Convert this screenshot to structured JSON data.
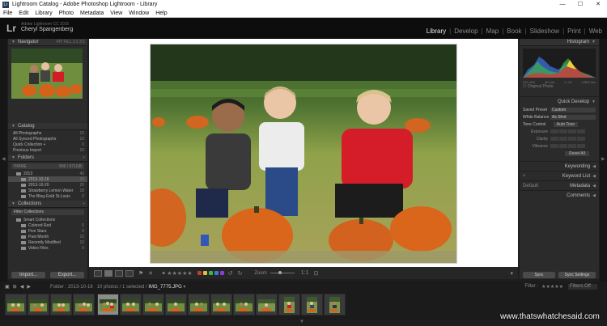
{
  "window": {
    "title": "Lightroom Catalog - Adobe Photoshop Lightroom - Library",
    "minimize": "—",
    "maximize": "☐",
    "close": "✕"
  },
  "menu": [
    "File",
    "Edit",
    "Library",
    "Photo",
    "Metadata",
    "View",
    "Window",
    "Help"
  ],
  "identity": {
    "logo": "Lr",
    "account": "Adobe Lightroom CC 2015",
    "user": "Cheryl Spangenberg"
  },
  "modules": [
    "Library",
    "Develop",
    "Map",
    "Book",
    "Slideshow",
    "Print",
    "Web"
  ],
  "active_module": "Library",
  "left_panel": {
    "navigator": {
      "title": "Navigator",
      "options": "FIT  FILL  1:1  3:1"
    },
    "catalog": {
      "title": "Catalog",
      "items": [
        {
          "label": "All Photographs",
          "count": "10"
        },
        {
          "label": "All Synced Photographs",
          "count": "10"
        },
        {
          "label": "Quick Collection +",
          "count": "0"
        },
        {
          "label": "Previous Import",
          "count": "10"
        }
      ]
    },
    "folders": {
      "title": "Folders",
      "volume": "PRIME",
      "volume_info": "906 / 971GB",
      "items": [
        {
          "label": "2013",
          "count": "40"
        },
        {
          "label": "2013-10-16",
          "count": "10"
        },
        {
          "label": "2013-10-20",
          "count": "20"
        },
        {
          "label": "Strawberry Lemon Water",
          "count": "18"
        },
        {
          "label": "The Blog-Gold St.Louis",
          "count": "0"
        }
      ]
    },
    "collections": {
      "title": "Collections",
      "filter": "Filter Collections",
      "items": [
        {
          "label": "Smart Collections",
          "count": ""
        },
        {
          "label": "Colored Red",
          "count": "0"
        },
        {
          "label": "Five Stars",
          "count": "0"
        },
        {
          "label": "Past Month",
          "count": "10"
        },
        {
          "label": "Recently Modified",
          "count": "10"
        },
        {
          "label": "Video Files",
          "count": "0"
        }
      ]
    },
    "import_label": "Import...",
    "export_label": "Export..."
  },
  "toolbar": {
    "rating": "★★★★★",
    "remove": "✕",
    "zoom_label": "Zoom"
  },
  "right_panel": {
    "histogram": {
      "title": "Histogram",
      "values": [
        "ISO 100",
        "30 mm",
        "f / 13",
        "1/500 sec"
      ],
      "original_photo": "Original Photo"
    },
    "quick_develop": {
      "title": "Quick Develop",
      "saved_preset_label": "Saved Preset",
      "saved_preset_value": "Custom",
      "white_balance_label": "White Balance",
      "white_balance_value": "As Shot",
      "tone_control_label": "Tone Control",
      "auto_tone": "Auto Tone",
      "exposure_label": "Exposure",
      "clarity_label": "Clarity",
      "vibrance_label": "Vibrance",
      "reset_all": "Reset All"
    },
    "keywording": "Keywording",
    "keyword_list": "Keyword List",
    "metadata": "Metadata",
    "metadata_preset": "Default",
    "comments": "Comments",
    "sync_label": "Sync",
    "sync_settings_label": "Sync Settings"
  },
  "filmstrip": {
    "folder": "Folder : 2013-10-16",
    "count": "10 photos / 1 selected /",
    "filename": "IMG_7775.JPG",
    "filter_label": "Filter :",
    "filter_stars": "★★★★★",
    "filter_value": "Filters Off"
  },
  "watermark": "www.thatswhatchesaid.com",
  "colors": {
    "accent": "#e6e6e6",
    "panel_bg": "#2b2b2b",
    "canvas_bg": "#ffffff"
  }
}
